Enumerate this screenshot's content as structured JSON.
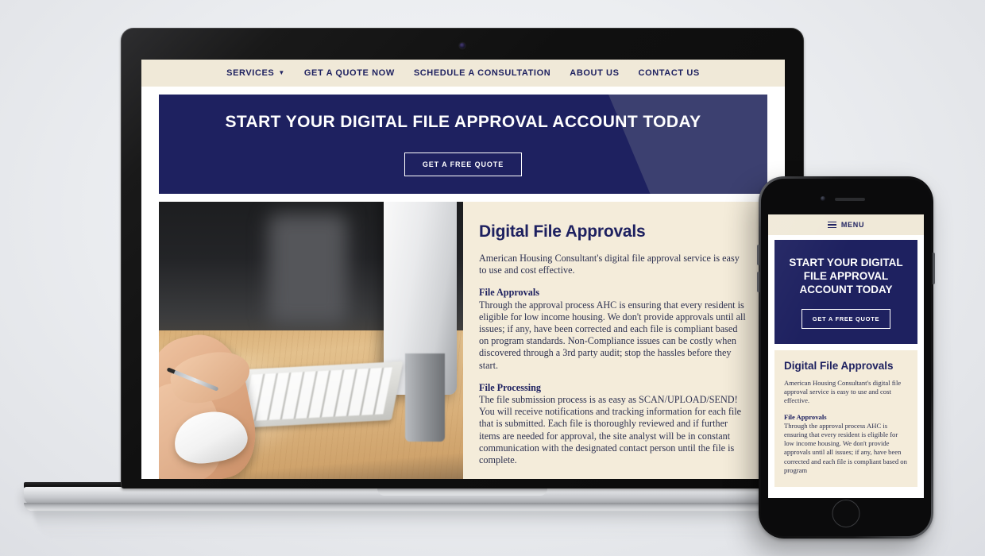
{
  "site": {
    "nav": {
      "items": [
        {
          "label": "Services",
          "has_dropdown": true,
          "icon": "chevron-down-icon"
        },
        {
          "label": "Get a Quote Now",
          "has_dropdown": false
        },
        {
          "label": "Schedule a Consultation",
          "has_dropdown": false
        },
        {
          "label": "About Us",
          "has_dropdown": false
        },
        {
          "label": "Contact Us",
          "has_dropdown": false
        }
      ]
    },
    "hero": {
      "title": "Start Your Digital File Approval Account Today",
      "button_label": "Get a Free Quote"
    },
    "main": {
      "heading": "Digital File Approvals",
      "intro": "American Housing Consultant's digital file approval service is easy to use and cost effective.",
      "sections": [
        {
          "subheading": "File Approvals",
          "body": "Through the approval process AHC is ensuring that every resident is eligible for low income housing. We don't provide approvals until all issues; if any, have been corrected and each file is compliant based on program standards. Non-Compliance issues can be costly when discovered through a 3rd party audit; stop the hassles before they start."
        },
        {
          "subheading": "File Processing",
          "body": "The file submission process is as easy as SCAN/UPLOAD/SEND! You will receive notifications and tracking information for each file that is submitted. Each file is thoroughly reviewed and if further items are needed for approval, the site analyst will be in constant communication with the designated contact person until the file is complete."
        }
      ],
      "photo_alt": "Hand holding a pen resting on a white mouse beside a keyboard and iMac on a wooden desk"
    }
  },
  "mobile": {
    "menu_label": "Menu",
    "menu_icon": "hamburger-icon",
    "hero": {
      "title": "Start Your Digital File Approval Account Today",
      "button_label": "Get a Free Quote"
    },
    "main": {
      "heading": "Digital File Approvals",
      "intro": "American Housing Consultant's digital file approval service is easy to use and cost effective.",
      "subheading": "File Approvals",
      "body": "Through the approval process AHC is ensuring that every resident is eligible for low income housing. We don't provide approvals until all issues; if any, have been corrected and each file is compliant based on program"
    }
  },
  "colors": {
    "navy": "#1e2160",
    "navy_light": "#3c4070",
    "cream": "#f0e9d8",
    "panel": "#f4ecda",
    "white": "#ffffff",
    "text": "#2d3150",
    "background": "#ebedf0"
  }
}
